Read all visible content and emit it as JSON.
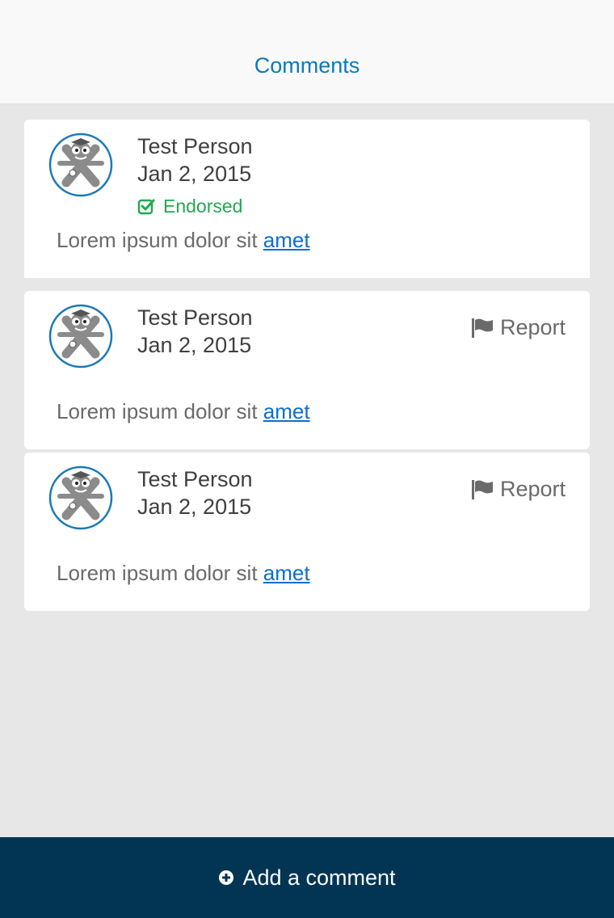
{
  "header": {
    "title": "Comments"
  },
  "comments": [
    {
      "author": "Test Person",
      "date": "Jan 2, 2015",
      "endorsed_label": "Endorsed",
      "body": "Lorem ipsum dolor sit",
      "link": "amet"
    },
    {
      "author": "Test Person",
      "date": "Jan 2, 2015",
      "report_label": "Report",
      "body": "Lorem ipsum dolor sit",
      "link": "amet"
    },
    {
      "author": "Test Person",
      "date": "Jan 2, 2015",
      "report_label": "Report",
      "body": "Lorem ipsum dolor sit",
      "link": "amet"
    }
  ],
  "footer": {
    "add_comment_label": "Add a comment"
  },
  "icons": {
    "endorsed": "check-square-icon",
    "report": "flag-icon",
    "add": "plus-circle-icon",
    "avatar": "mascot-avatar-icon"
  },
  "colors": {
    "accent": "#0a7ab8",
    "endorsed": "#22a94f",
    "footer_bg": "#023553",
    "link": "#0a6ed1"
  }
}
